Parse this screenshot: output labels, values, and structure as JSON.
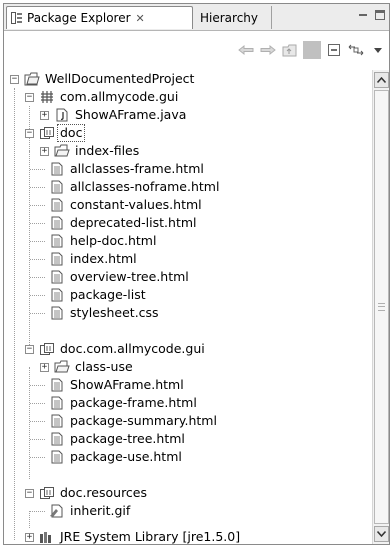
{
  "tabs": {
    "active_label": "Package Explorer",
    "close_glyph": "✕",
    "inactive_label": "Hierarchy"
  },
  "toolbar_icons": [
    "back-arrow-icon",
    "forward-arrow-icon",
    "up-folder-icon",
    "collapse-all-icon",
    "link-with-editor-icon",
    "view-menu-icon"
  ],
  "tree": {
    "root": "WellDocumentedProject",
    "pkg_gui": "com.allmycode.gui",
    "showaframe_java": "ShowAFrame.java",
    "doc": "doc",
    "index_files": "index-files",
    "doc_files": [
      "allclasses-frame.html",
      "allclasses-noframe.html",
      "constant-values.html",
      "deprecated-list.html",
      "help-doc.html",
      "index.html",
      "overview-tree.html",
      "package-list",
      "stylesheet.css"
    ],
    "doc_gui": "doc.com.allmycode.gui",
    "class_use": "class-use",
    "gui_files": [
      "ShowAFrame.html",
      "package-frame.html",
      "package-summary.html",
      "package-tree.html",
      "package-use.html"
    ],
    "doc_resources": "doc.resources",
    "inherit_gif": "inherit.gif",
    "jre": "JRE System Library [jre1.5.0]"
  }
}
